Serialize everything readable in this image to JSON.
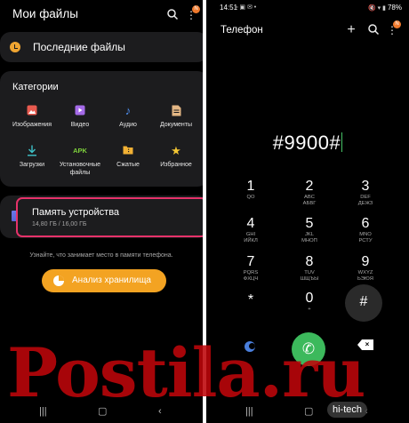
{
  "left_app": {
    "title": "Мои файлы",
    "header_icons": [
      "search-icon",
      "more-vert-icon"
    ],
    "badge": "N",
    "recent": {
      "label": "Последние файлы",
      "icon": "clock-icon"
    },
    "categories": {
      "title": "Категории",
      "items": [
        {
          "label": "Изображения",
          "icon": "image-icon",
          "color": "#e85a4f"
        },
        {
          "label": "Видео",
          "icon": "video-icon",
          "color": "#a46ae8"
        },
        {
          "label": "Аудио",
          "icon": "music-note-icon",
          "color": "#4f8ff0"
        },
        {
          "label": "Документы",
          "icon": "document-icon",
          "color": "#e3b684"
        },
        {
          "label": "Загрузки",
          "icon": "download-icon",
          "color": "#3ec3c9"
        },
        {
          "label": "Установочные файлы",
          "icon": "apk-icon",
          "color": "#7ed13c"
        },
        {
          "label": "Сжатые",
          "icon": "zip-folder-icon",
          "color": "#f2b134"
        },
        {
          "label": "Избранное",
          "icon": "star-icon",
          "color": "#f2c533"
        }
      ]
    },
    "storage": {
      "title": "Память устройства",
      "usage": "14,80 ГБ / 16,00 ГБ"
    },
    "hint": "Узнайте, что занимает место в памяти телефона.",
    "analyze_button": "Анализ хранилища",
    "navbar": [
      "recents-icon",
      "home-icon",
      "back-icon"
    ]
  },
  "right_app": {
    "status": {
      "time": "14:51",
      "icons": "▫ ▣ ✉ •",
      "right": "78%",
      "right_icons": "🔇 ▾ ▮"
    },
    "title": "Телефон",
    "badge": "N",
    "dialed_number": "#9900#",
    "keys": [
      {
        "digit": "1",
        "letters": "QO"
      },
      {
        "digit": "2",
        "letters": "ABC\nАБВГ"
      },
      {
        "digit": "3",
        "letters": "DEF\nДЕЖЗ"
      },
      {
        "digit": "4",
        "letters": "GHI\nИЙКЛ"
      },
      {
        "digit": "5",
        "letters": "JKL\nМНОП"
      },
      {
        "digit": "6",
        "letters": "MNO\nРСТУ"
      },
      {
        "digit": "7",
        "letters": "PQRS\nФХЦЧ"
      },
      {
        "digit": "8",
        "letters": "TUV\nШЩЪЫ"
      },
      {
        "digit": "9",
        "letters": "WXYZ\nЬЭЮЯ"
      },
      {
        "digit": "*",
        "letters": ""
      },
      {
        "digit": "0",
        "letters": "+"
      },
      {
        "digit": "#",
        "letters": ""
      }
    ],
    "bottom_icons": [
      "voicemail-icon",
      "call-icon",
      "backspace-icon"
    ],
    "navbar": [
      "recents-icon",
      "home-icon",
      "back-icon"
    ]
  },
  "watermark": {
    "text": "Postila.ru",
    "logo": "hi-tech"
  }
}
